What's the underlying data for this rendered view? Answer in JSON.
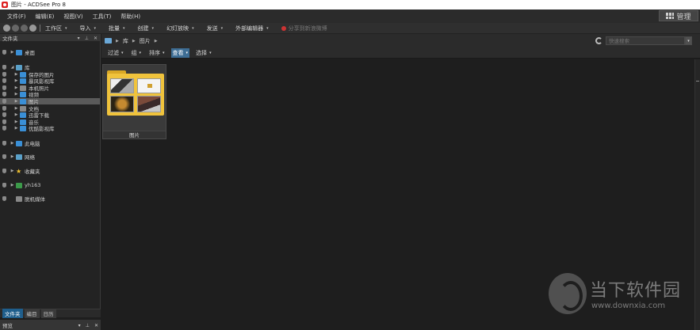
{
  "window": {
    "title": "图片 - ACDSee Pro 8"
  },
  "menubar": {
    "items": [
      "文件(F)",
      "编辑(E)",
      "视图(V)",
      "工具(T)",
      "帮助(H)"
    ],
    "manage_label": "管理"
  },
  "toolbar": {
    "items": [
      {
        "label": "工作区",
        "caret": "▾"
      },
      {
        "label": "导入",
        "caret": "▾"
      },
      {
        "label": "批量",
        "caret": "▾"
      },
      {
        "label": "创建",
        "caret": "▾"
      },
      {
        "label": "幻灯放映",
        "caret": "▾"
      },
      {
        "label": "发送",
        "caret": "▾"
      },
      {
        "label": "外部编辑器",
        "caret": "▾"
      }
    ],
    "share_label": "分享到新浪微博"
  },
  "left_panel": {
    "title": "文件夹",
    "tree": [
      {
        "label": "桌面",
        "icon": "desktop-icon"
      },
      {
        "label": "库",
        "icon": "library-icon"
      },
      {
        "label": "保存的图片",
        "icon": "folder-icon"
      },
      {
        "label": "暴风影视库",
        "icon": "folder-icon"
      },
      {
        "label": "本机照片",
        "icon": "folder-icon"
      },
      {
        "label": "视频",
        "icon": "video-icon"
      },
      {
        "label": "图片",
        "icon": "pictures-icon"
      },
      {
        "label": "文档",
        "icon": "document-icon"
      },
      {
        "label": "迅雷下载",
        "icon": "folder-icon"
      },
      {
        "label": "音乐",
        "icon": "music-icon"
      },
      {
        "label": "优酷影视库",
        "icon": "folder-icon"
      },
      {
        "label": "此电脑",
        "icon": "computer-icon"
      },
      {
        "label": "网络",
        "icon": "network-icon"
      },
      {
        "label": "收藏夹",
        "icon": "star-icon"
      },
      {
        "label": "yh163",
        "icon": "user-icon"
      },
      {
        "label": "脱机媒体",
        "icon": "offline-media-icon"
      }
    ],
    "tabs": [
      "文件夹",
      "编目",
      "日历"
    ],
    "preview_title": "预览"
  },
  "addressbar": {
    "crumbs": [
      "库",
      "图片"
    ],
    "search_placeholder": "快速搜索"
  },
  "filterbar": {
    "items": [
      "过滤",
      "组",
      "排序",
      "查看",
      "选择"
    ],
    "active": "查看"
  },
  "content": {
    "folder_label": "图片"
  },
  "watermark": {
    "title": "当下软件园",
    "url": "www.downxia.com"
  }
}
